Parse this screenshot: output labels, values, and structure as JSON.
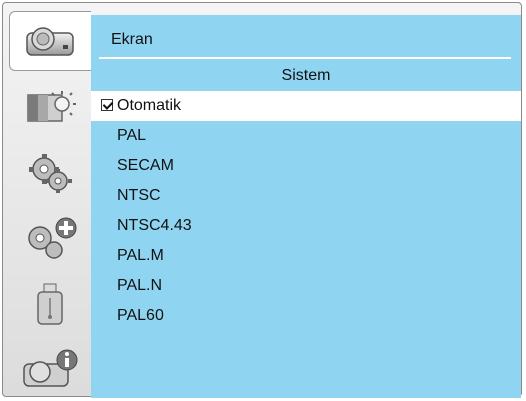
{
  "menu": {
    "tabs": [
      {
        "icon": "projector-icon",
        "active": true
      },
      {
        "icon": "picture-brightness-icon",
        "active": false
      },
      {
        "icon": "gear-icon",
        "active": false
      },
      {
        "icon": "gear-plus-icon",
        "active": false
      },
      {
        "icon": "usb-drive-icon",
        "active": false
      },
      {
        "icon": "projector-info-icon",
        "active": false
      }
    ]
  },
  "panel": {
    "title": "Ekran",
    "section": "Sistem",
    "selected_index": 0,
    "options": [
      {
        "label": "Otomatik",
        "checked": true
      },
      {
        "label": "PAL"
      },
      {
        "label": "SECAM"
      },
      {
        "label": "NTSC"
      },
      {
        "label": "NTSC4.43"
      },
      {
        "label": "PAL.M"
      },
      {
        "label": "PAL.N"
      },
      {
        "label": "PAL60"
      }
    ]
  },
  "colors": {
    "panel": "#8fd5f2",
    "highlight": "#ffffff"
  }
}
